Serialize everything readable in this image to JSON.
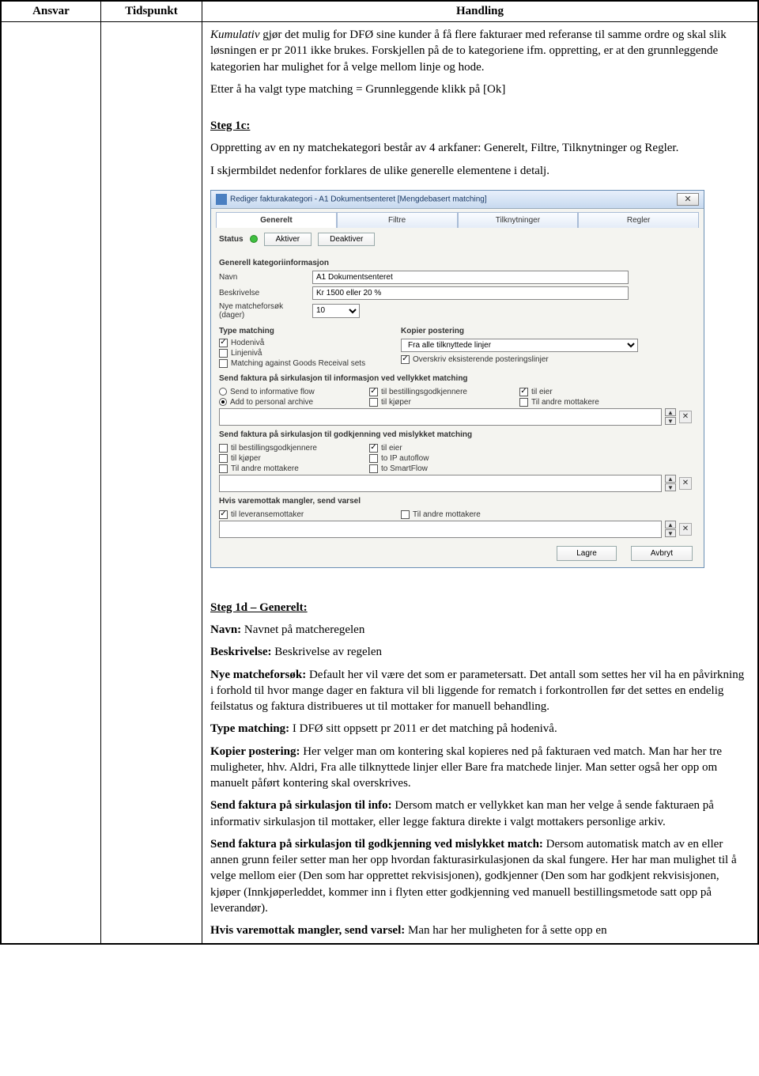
{
  "table": {
    "headers": {
      "ansvar": "Ansvar",
      "tidspunkt": "Tidspunkt",
      "handling": "Handling"
    }
  },
  "para": {
    "kumulativ_label": "Kumulativ",
    "kumulativ_rest": " gjør det mulig for DFØ sine kunder å få flere fakturaer med referanse til samme ordre og skal slik løsningen er pr 2011 ikke brukes. Forskjellen på de to kategoriene ifm. oppretting, er at den grunnleggende kategorien har mulighet for å velge mellom linje og hode.",
    "etter_valgt": "Etter å ha valgt type matching = Grunnleggende klikk på [Ok]",
    "step1c_head": "Steg 1c:",
    "step1c_p1": "Oppretting av en ny matchekategori består av 4 arkfaner: Generelt, Filtre, Tilknytninger og Regler.",
    "step1c_p2": "I skjermbildet nedenfor forklares de ulike generelle elementene i detalj.",
    "step1d_head": "Steg 1d – Generelt:",
    "navn_lbl": "Navn:",
    "navn_txt": " Navnet på matcheregelen",
    "besk_lbl": "Beskrivelse:",
    "besk_txt": " Beskrivelse av regelen",
    "nye_lbl": "Nye matcheforsøk:",
    "nye_txt": " Default her vil være det som er parametersatt. Det antall som settes her vil ha en påvirkning i forhold til hvor mange dager en faktura vil bli liggende for rematch i forkontrollen før det settes en endelig feilstatus og faktura distribueres ut til mottaker for manuell behandling.",
    "type_lbl": "Type matching:",
    "type_txt": " I DFØ sitt oppsett pr 2011 er det matching på hodenivå.",
    "kopier_lbl": "Kopier postering:",
    "kopier_txt": " Her velger man om kontering skal kopieres ned på fakturaen ved match. Man har her tre muligheter, hhv. Aldri, Fra alle tilknyttede linjer eller Bare fra matchede linjer. Man setter også her opp om manuelt påført kontering skal overskrives.",
    "info_lbl": "Send faktura på sirkulasjon til info:",
    "info_txt": " Dersom match er vellykket kan man her velge å sende fakturaen på informativ sirkulasjon til mottaker, eller legge faktura direkte i valgt mottakers personlige arkiv.",
    "godk_lbl": "Send faktura på sirkulasjon til godkjenning ved mislykket match:",
    "godk_txt": " Dersom automatisk match av en eller annen grunn feiler setter man her opp hvordan fakturasirkulasjonen da skal fungere. Her har man mulighet til å velge mellom eier (Den som har opprettet rekvisisjonen), godkjenner (Den som har godkjent rekvisisjonen, kjøper (Innkjøperleddet, kommer inn i flyten etter godkjenning ved manuell bestillingsmetode satt opp på leverandør).",
    "varsel_lbl": "Hvis varemottak mangler, send varsel:",
    "varsel_txt": " Man har her muligheten for å sette opp en"
  },
  "dialog": {
    "title": "Rediger fakturakategori - A1 Dokumentsenteret [Mengdebasert matching]",
    "tabs": {
      "generelt": "Generelt",
      "filtre": "Filtre",
      "tilknytninger": "Tilknytninger",
      "regler": "Regler"
    },
    "status_lbl": "Status",
    "aktiver": "Aktiver",
    "deaktiver": "Deaktiver",
    "sec_generell": "Generell kategoriinformasjon",
    "navn_lbl": "Navn",
    "navn_val": "A1 Dokumentsenteret",
    "besk_lbl": "Beskrivelse",
    "besk_val": "Kr 1500 eller 20 %",
    "nye_lbl": "Nye matcheforsøk (dager)",
    "nye_val": "10",
    "type_head": "Type matching",
    "hodeniva": "Hodenivå",
    "linjeniva": "Linjenivå",
    "goods": "Matching against Goods Receival sets",
    "kopier_head": "Kopier postering",
    "kopier_sel": "Fra alle tilknyttede linjer",
    "overskriv": "Overskriv eksisterende posteringslinjer",
    "sec_vellykket": "Send faktura på sirkulasjon til informasjon ved vellykket matching",
    "send_flow": "Send to informative flow",
    "add_archive": "Add to personal archive",
    "til_best_godk": "til bestillingsgodkjennere",
    "til_kjoper": "til kjøper",
    "til_eier": "til eier",
    "til_andre": "Til andre mottakere",
    "sec_mislykket": "Send faktura på sirkulasjon til godkjenning ved mislykket matching",
    "to_ip": "to IP autoflow",
    "to_smart": "to SmartFlow",
    "sec_varsel": "Hvis varemottak mangler, send varsel",
    "til_lev": "til leveransemottaker",
    "lagre": "Lagre",
    "avbryt": "Avbryt"
  }
}
